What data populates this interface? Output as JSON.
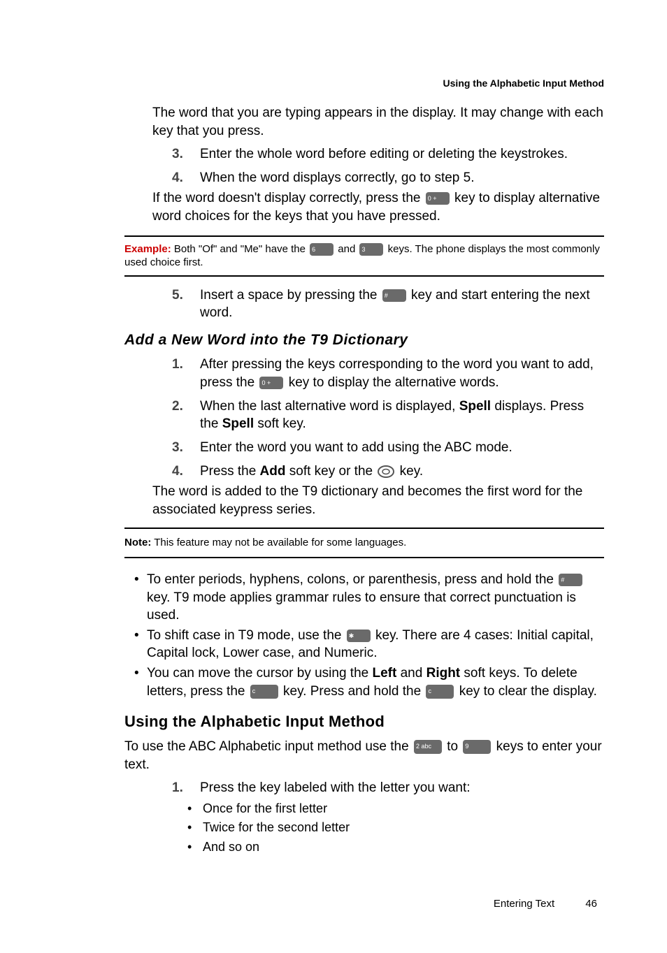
{
  "header": "Using the Alphabetic Input Method",
  "intro_continuation": "The word that you are typing appears in the display. It may change with each key that you press.",
  "steps_a": [
    {
      "num": "3.",
      "text": "Enter the whole word before editing or deleting the keystrokes."
    },
    {
      "num": "4.",
      "text": "When the word displays correctly, go to step 5."
    }
  ],
  "step4_extra_pre": "If the word doesn't display correctly, press the ",
  "step4_extra_post": " key to display alternative word choices for the keys that you have pressed.",
  "example": {
    "label": "Example:",
    "pre": " Both \"Of\" and \"Me\" have the ",
    "mid": " and ",
    "post": " keys. The phone displays the most commonly used choice first."
  },
  "step5": {
    "num": "5.",
    "pre": "Insert a space by pressing the ",
    "post": " key and start entering the next word."
  },
  "subhead": "Add a New Word into the T9 Dictionary",
  "dict_steps": {
    "s1": {
      "num": "1.",
      "pre": "After pressing the keys corresponding to the word you want to add, press the ",
      "post": " key to display the alternative words."
    },
    "s2": {
      "num": "2.",
      "pre": "When the last alternative word is displayed, ",
      "bold1": "Spell",
      "mid": " displays. Press the ",
      "bold2": "Spell",
      "post": " soft key."
    },
    "s3": {
      "num": "3.",
      "text": "Enter the word you want to add using the ABC mode."
    },
    "s4": {
      "num": "4.",
      "pre": "Press the ",
      "bold": "Add",
      "mid": " soft key or the ",
      "post": " key."
    },
    "s4_extra": "The word is added to the T9 dictionary and becomes the first word for the associated keypress series."
  },
  "note": {
    "label": "Note:",
    "text": " This feature may not be available for some languages."
  },
  "bullets": {
    "b1_pre": "To enter periods, hyphens, colons, or parenthesis, press and hold the ",
    "b1_post": " key. T9 mode applies grammar rules to ensure that correct punctuation is used.",
    "b2_pre": "To shift case in T9 mode, use the ",
    "b2_post": " key. There are 4 cases: Initial capital, Capital lock, Lower case, and Numeric.",
    "b3_pre": "You can move the cursor by using the ",
    "b3_bold1": "Left",
    "b3_mid1": " and ",
    "b3_bold2": "Right",
    "b3_mid2": " soft keys. To delete letters, press the ",
    "b3_mid3": " key. Press and hold the ",
    "b3_post": " key to clear the display."
  },
  "section_head": "Using the Alphabetic Input Method",
  "alpha_intro_pre": "To use the ABC Alphabetic input method use the ",
  "alpha_intro_mid": " to ",
  "alpha_intro_post": " keys to enter your text.",
  "alpha_step": {
    "num": "1.",
    "text": "Press the key labeled with the letter you want:"
  },
  "nested": [
    "Once for the first letter",
    "Twice for the second letter",
    "And so on"
  ],
  "footer": {
    "section": "Entering Text",
    "page": "46"
  },
  "keys": {
    "zero": "0 +",
    "six": "6",
    "three": "3",
    "hash": "#",
    "star": "✱",
    "two": "2 abc",
    "nine": "9",
    "clear": "c"
  }
}
